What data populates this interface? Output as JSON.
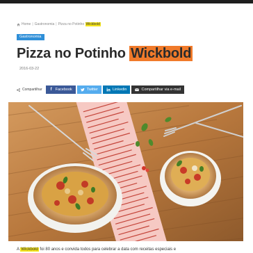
{
  "breadcrumb": {
    "home": "Home",
    "section": "Gastronomia",
    "page_prefix": "Pizza no Potinho",
    "page_highlight": "Wickbold"
  },
  "category": "Gastronomia",
  "article": {
    "title_prefix": "Pizza no Potinho",
    "title_highlight": "Wickbold",
    "date": "2016-03-22",
    "body_prefix": "A",
    "body_highlight": "Wickbold",
    "body_rest": "foi 80 anos e convida todos para celebrar a data com receitas especiais e"
  },
  "share": {
    "label": "Compartilhar",
    "facebook": "Facebook",
    "twitter": "Twitter",
    "linkedin": "Linkedin",
    "email": "Compartilhar via e-mail"
  },
  "icons": {
    "home": "home-icon",
    "share": "share-icon",
    "facebook": "facebook-icon",
    "twitter": "twitter-icon",
    "linkedin": "linkedin-icon",
    "email": "email-icon"
  },
  "colors": {
    "topbar": "#1e1e1e",
    "category": "#2f8fd8",
    "title_highlight": "#f07a2a",
    "text_highlight": "#f5e51a",
    "facebook": "#3b5998",
    "twitter": "#55acee",
    "linkedin": "#0077b5",
    "email": "#333333"
  }
}
